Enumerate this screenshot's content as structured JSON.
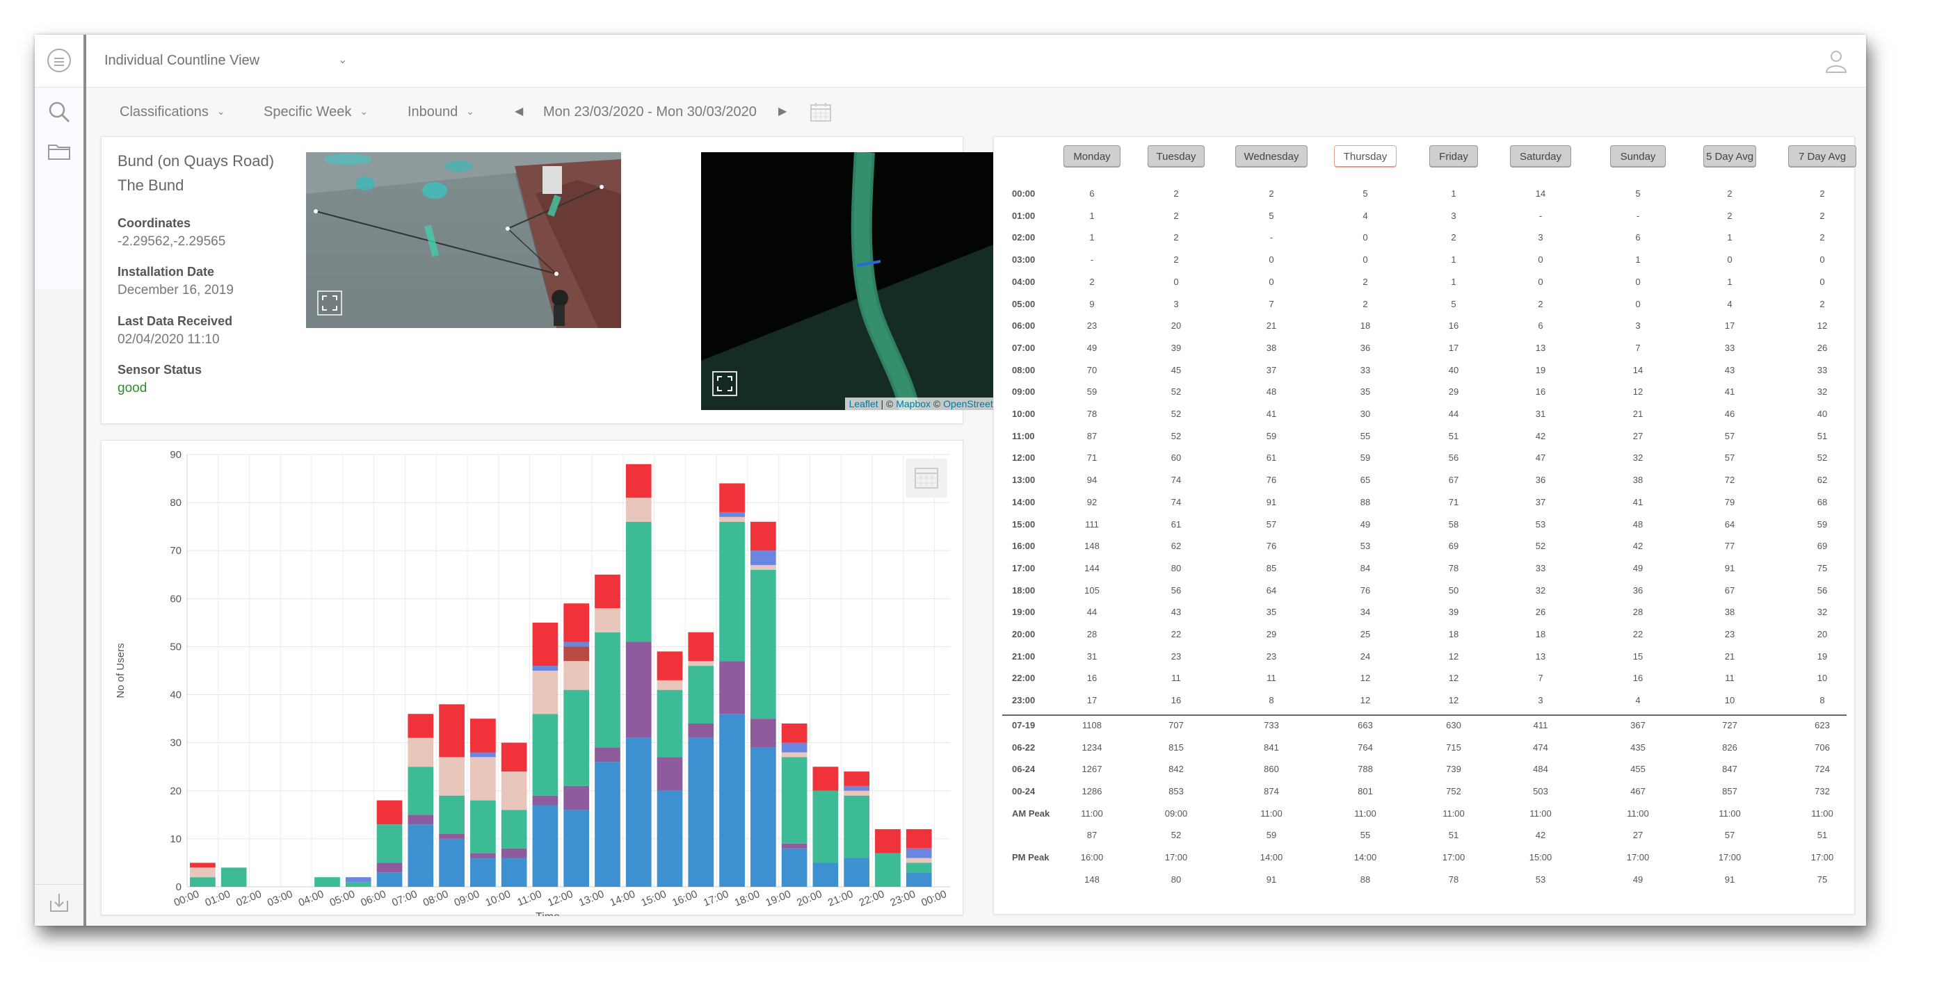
{
  "header": {
    "view_select": "Individual Countline View"
  },
  "toolbar": {
    "classifications": "Classifications",
    "period": "Specific Week",
    "direction": "Inbound",
    "date_range": "Mon 23/03/2020 - Mon 30/03/2020"
  },
  "info": {
    "site_name_1": "Bund (on Quays Road)",
    "site_name_2": "The Bund",
    "coordinates_label": "Coordinates",
    "coordinates_value": "-2.29562,-2.29565",
    "installation_label": "Installation Date",
    "installation_value": "December 16, 2019",
    "last_data_label": "Last Data Received",
    "last_data_value": "02/04/2020 11:10",
    "status_label": "Sensor Status",
    "status_value": "good"
  },
  "map": {
    "attr_leaflet": "Leaflet",
    "attr_sep1": " | © ",
    "attr_mapbox": "Mapbox",
    "attr_sep2": " © ",
    "attr_osm": "OpenStreetMap"
  },
  "colors": {
    "blue": "#3d91d0",
    "purple": "#8e5b9c",
    "teal": "#3dbb96",
    "pink": "#e8c6bc",
    "red": "#f0323a",
    "darkred": "#b84a44",
    "lightblue": "#6a86e0",
    "green_status": "#2e8b2e"
  },
  "chart_data": {
    "type": "bar",
    "stacked": true,
    "xlabel": "Time",
    "ylabel": "No of Users",
    "ylim": [
      0,
      90
    ],
    "yticks": [
      0,
      10,
      20,
      30,
      40,
      50,
      60,
      70,
      80,
      90
    ],
    "grid": true,
    "categories": [
      "00:00",
      "01:00",
      "02:00",
      "03:00",
      "04:00",
      "05:00",
      "06:00",
      "07:00",
      "08:00",
      "09:00",
      "10:00",
      "11:00",
      "12:00",
      "13:00",
      "14:00",
      "15:00",
      "16:00",
      "17:00",
      "18:00",
      "19:00",
      "20:00",
      "21:00",
      "22:00",
      "23:00",
      "00:00"
    ],
    "series": [
      {
        "color": "#3d91d0",
        "values": [
          0,
          0,
          0,
          0,
          0,
          0,
          3,
          13,
          10,
          6,
          6,
          17,
          16,
          26,
          31,
          20,
          31,
          36,
          29,
          8,
          5,
          6,
          0,
          3,
          0
        ]
      },
      {
        "color": "#8e5b9c",
        "values": [
          0,
          0,
          0,
          0,
          0,
          0,
          2,
          2,
          1,
          1,
          2,
          2,
          5,
          3,
          20,
          7,
          3,
          11,
          6,
          1,
          0,
          0,
          0,
          0,
          0
        ]
      },
      {
        "color": "#3dbb96",
        "values": [
          2,
          4,
          0,
          0,
          2,
          1,
          8,
          10,
          8,
          11,
          8,
          17,
          20,
          24,
          25,
          14,
          12,
          29,
          31,
          18,
          15,
          13,
          7,
          2,
          0
        ]
      },
      {
        "color": "#e8c6bc",
        "values": [
          2,
          0,
          0,
          0,
          0,
          0,
          0,
          6,
          8,
          9,
          8,
          9,
          6,
          5,
          5,
          2,
          1,
          1,
          1,
          1,
          0,
          1,
          0,
          1,
          0
        ]
      },
      {
        "color": "#b84a44",
        "values": [
          0,
          0,
          0,
          0,
          0,
          0,
          0,
          0,
          0,
          0,
          0,
          0,
          3,
          0,
          0,
          0,
          0,
          0,
          0,
          0,
          0,
          0,
          0,
          0,
          0
        ]
      },
      {
        "color": "#6a86e0",
        "values": [
          0,
          0,
          0,
          0,
          0,
          1,
          0,
          0,
          0,
          1,
          0,
          1,
          1,
          0,
          0,
          0,
          0,
          1,
          3,
          2,
          0,
          1,
          0,
          2,
          0
        ]
      },
      {
        "color": "#f0323a",
        "values": [
          1,
          0,
          0,
          0,
          0,
          0,
          5,
          5,
          11,
          7,
          6,
          9,
          8,
          7,
          7,
          6,
          6,
          6,
          6,
          4,
          5,
          3,
          5,
          4,
          0
        ]
      }
    ]
  },
  "table": {
    "days": [
      "Monday",
      "Tuesday",
      "Wednesday",
      "Thursday",
      "Friday",
      "Saturday",
      "Sunday",
      "5 Day Avg",
      "7 Day Avg"
    ],
    "active_day": 3,
    "hours": [
      {
        "label": "00:00",
        "values": [
          "6",
          "2",
          "2",
          "5",
          "1",
          "14",
          "5",
          "2",
          "2"
        ]
      },
      {
        "label": "01:00",
        "values": [
          "1",
          "2",
          "5",
          "4",
          "3",
          "-",
          "-",
          "2",
          "2"
        ]
      },
      {
        "label": "02:00",
        "values": [
          "1",
          "2",
          "-",
          "0",
          "2",
          "3",
          "6",
          "1",
          "2"
        ]
      },
      {
        "label": "03:00",
        "values": [
          "-",
          "2",
          "0",
          "0",
          "1",
          "0",
          "1",
          "0",
          "0"
        ]
      },
      {
        "label": "04:00",
        "values": [
          "2",
          "0",
          "0",
          "2",
          "1",
          "0",
          "0",
          "1",
          "0"
        ]
      },
      {
        "label": "05:00",
        "values": [
          "9",
          "3",
          "7",
          "2",
          "5",
          "2",
          "0",
          "4",
          "2"
        ]
      },
      {
        "label": "06:00",
        "values": [
          "23",
          "20",
          "21",
          "18",
          "16",
          "6",
          "3",
          "17",
          "12"
        ]
      },
      {
        "label": "07:00",
        "values": [
          "49",
          "39",
          "38",
          "36",
          "17",
          "13",
          "7",
          "33",
          "26"
        ]
      },
      {
        "label": "08:00",
        "values": [
          "70",
          "45",
          "37",
          "33",
          "40",
          "19",
          "14",
          "43",
          "33"
        ]
      },
      {
        "label": "09:00",
        "values": [
          "59",
          "52",
          "48",
          "35",
          "29",
          "16",
          "12",
          "41",
          "32"
        ]
      },
      {
        "label": "10:00",
        "values": [
          "78",
          "52",
          "41",
          "30",
          "44",
          "31",
          "21",
          "46",
          "40"
        ]
      },
      {
        "label": "11:00",
        "values": [
          "87",
          "52",
          "59",
          "55",
          "51",
          "42",
          "27",
          "57",
          "51"
        ]
      },
      {
        "label": "12:00",
        "values": [
          "71",
          "60",
          "61",
          "59",
          "56",
          "47",
          "32",
          "57",
          "52"
        ]
      },
      {
        "label": "13:00",
        "values": [
          "94",
          "74",
          "76",
          "65",
          "67",
          "36",
          "38",
          "72",
          "62"
        ]
      },
      {
        "label": "14:00",
        "values": [
          "92",
          "74",
          "91",
          "88",
          "71",
          "37",
          "41",
          "79",
          "68"
        ]
      },
      {
        "label": "15:00",
        "values": [
          "111",
          "61",
          "57",
          "49",
          "58",
          "53",
          "48",
          "64",
          "59"
        ]
      },
      {
        "label": "16:00",
        "values": [
          "148",
          "62",
          "76",
          "53",
          "69",
          "52",
          "42",
          "77",
          "69"
        ]
      },
      {
        "label": "17:00",
        "values": [
          "144",
          "80",
          "85",
          "84",
          "78",
          "33",
          "49",
          "91",
          "75"
        ]
      },
      {
        "label": "18:00",
        "values": [
          "105",
          "56",
          "64",
          "76",
          "50",
          "32",
          "36",
          "67",
          "56"
        ]
      },
      {
        "label": "19:00",
        "values": [
          "44",
          "43",
          "35",
          "34",
          "39",
          "26",
          "28",
          "38",
          "32"
        ]
      },
      {
        "label": "20:00",
        "values": [
          "28",
          "22",
          "29",
          "25",
          "18",
          "18",
          "22",
          "23",
          "20"
        ]
      },
      {
        "label": "21:00",
        "values": [
          "31",
          "23",
          "23",
          "24",
          "12",
          "13",
          "15",
          "21",
          "19"
        ]
      },
      {
        "label": "22:00",
        "values": [
          "16",
          "11",
          "11",
          "12",
          "12",
          "7",
          "16",
          "11",
          "10"
        ]
      },
      {
        "label": "23:00",
        "values": [
          "17",
          "16",
          "8",
          "12",
          "12",
          "3",
          "4",
          "10",
          "8"
        ]
      }
    ],
    "summary": [
      {
        "label": "07-19",
        "values": [
          "1108",
          "707",
          "733",
          "663",
          "630",
          "411",
          "367",
          "727",
          "623"
        ]
      },
      {
        "label": "06-22",
        "values": [
          "1234",
          "815",
          "841",
          "764",
          "715",
          "474",
          "435",
          "826",
          "706"
        ]
      },
      {
        "label": "06-24",
        "values": [
          "1267",
          "842",
          "860",
          "788",
          "739",
          "484",
          "455",
          "847",
          "724"
        ]
      },
      {
        "label": "00-24",
        "values": [
          "1286",
          "853",
          "874",
          "801",
          "752",
          "503",
          "467",
          "857",
          "732"
        ]
      },
      {
        "label": "AM Peak",
        "values": [
          "11:00",
          "09:00",
          "11:00",
          "11:00",
          "11:00",
          "11:00",
          "11:00",
          "11:00",
          "11:00"
        ]
      },
      {
        "label": "",
        "values": [
          "87",
          "52",
          "59",
          "55",
          "51",
          "42",
          "27",
          "57",
          "51"
        ]
      },
      {
        "label": "PM Peak",
        "values": [
          "16:00",
          "17:00",
          "14:00",
          "14:00",
          "17:00",
          "15:00",
          "17:00",
          "17:00",
          "17:00"
        ]
      },
      {
        "label": "",
        "values": [
          "148",
          "80",
          "91",
          "88",
          "78",
          "53",
          "49",
          "91",
          "75"
        ]
      }
    ]
  }
}
